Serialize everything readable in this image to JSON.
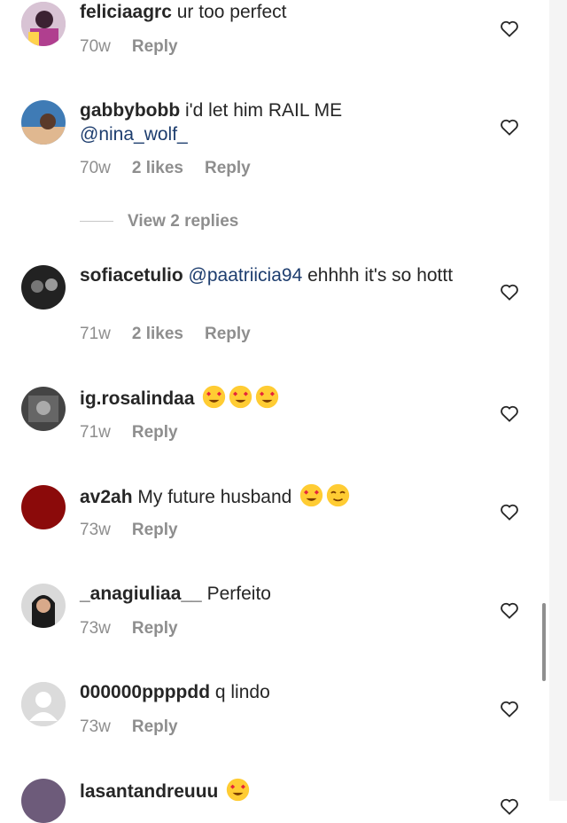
{
  "comments": [
    {
      "username": "feliciaagrc",
      "text": " ur too perfect",
      "mention": "",
      "text_after": "",
      "age": "70w",
      "likes": "",
      "reply": "Reply",
      "emoji": []
    },
    {
      "username": "gabbybobb",
      "text": " i'd let him RAIL ME",
      "mention": "@nina_wolf_",
      "text_after": "",
      "age": "70w",
      "likes": "2 likes",
      "reply": "Reply",
      "emoji": []
    },
    {
      "username": "sofiacetulio",
      "text": " ",
      "mention": "@paatriicia94",
      "text_after": "  ehhhh it's so hottt",
      "age": "71w",
      "likes": "2 likes",
      "reply": "Reply",
      "emoji": []
    },
    {
      "username": "ig.rosalindaa",
      "text": " ",
      "mention": "",
      "text_after": "",
      "age": "71w",
      "likes": "",
      "reply": "Reply",
      "emoji": [
        "heart-eyes",
        "heart-eyes",
        "heart-eyes"
      ]
    },
    {
      "username": "av2ah",
      "text": " My future husband ",
      "mention": "",
      "text_after": "",
      "age": "73w",
      "likes": "",
      "reply": "Reply",
      "emoji": [
        "heart-eyes",
        "relieved"
      ]
    },
    {
      "username": "_anagiuliaa__",
      "text": " Perfeito",
      "mention": "",
      "text_after": "",
      "age": "73w",
      "likes": "",
      "reply": "Reply",
      "emoji": []
    },
    {
      "username": "000000ppppdd",
      "text": " q lindo",
      "mention": "",
      "text_after": "",
      "age": "73w",
      "likes": "",
      "reply": "Reply",
      "emoji": []
    },
    {
      "username": "lasantandreuuu",
      "text": " ",
      "mention": "",
      "text_after": "",
      "age": "",
      "likes": "",
      "reply": "",
      "emoji": [
        "heart-eyes"
      ]
    }
  ],
  "view_replies": "View 2 replies",
  "colors": {
    "mention": "#1d3d6e",
    "secondary": "#8e8e8e",
    "text": "#262626"
  },
  "icons": {
    "like": "heart-outline-icon"
  }
}
